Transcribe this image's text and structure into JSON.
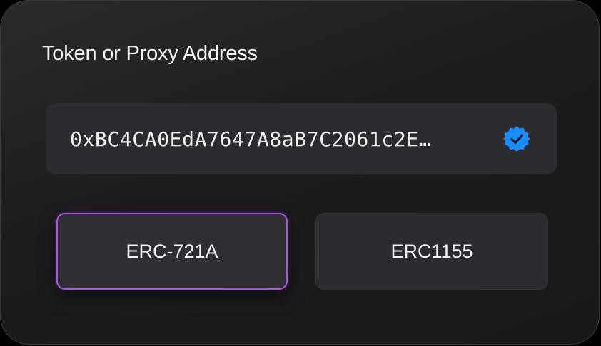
{
  "form": {
    "address_label": "Token or Proxy Address",
    "address_value": "0xBC4CA0EdA7647A8aB7C2061c2E…",
    "verified_icon": "verified-check-badge",
    "accent_color": "#b04fe8",
    "verified_color": "#1a8cff"
  },
  "token_standard": {
    "options": [
      {
        "label": "ERC-721A",
        "selected": true
      },
      {
        "label": "ERC1155",
        "selected": false
      }
    ]
  }
}
